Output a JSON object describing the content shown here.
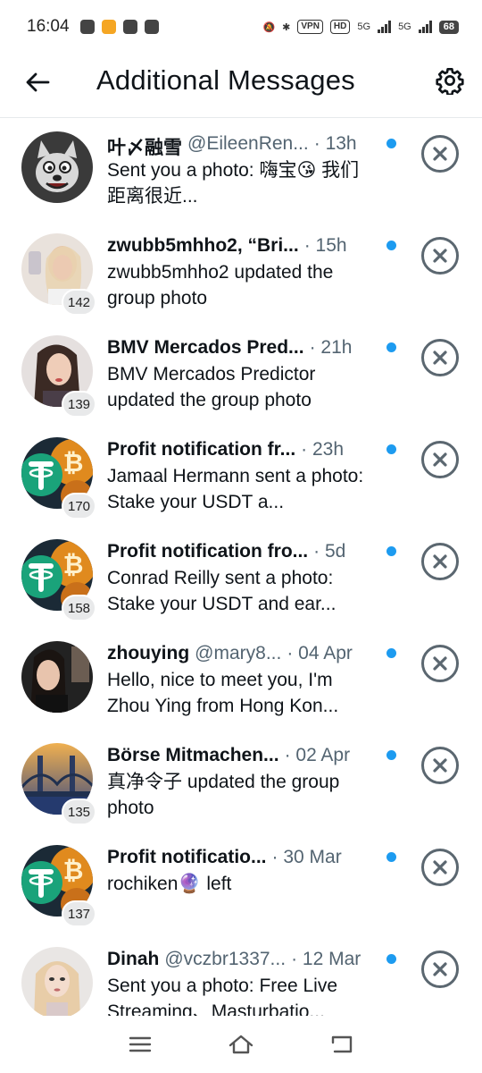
{
  "status_bar": {
    "time": "16:04",
    "vpn": "VPN",
    "hd": "HD",
    "net1": "5G",
    "net2": "5G",
    "battery": "68"
  },
  "header": {
    "title": "Additional Messages"
  },
  "colors": {
    "accent_dot": "#1d9bf0",
    "muted_text": "#536471"
  },
  "messages": [
    {
      "name": "叶〆融雪",
      "handle": "@EileenRen...",
      "time": "13h",
      "preview": "Sent you a photo: 嗨宝😘 我们距离很近...",
      "badge": "",
      "avatar": "cartoon-wolf"
    },
    {
      "name": "zwubb5mhho2, “Bri...",
      "handle": "",
      "time": "15h",
      "preview": "zwubb5mhho2 updated the group photo",
      "badge": "142",
      "avatar": "woman-selfie"
    },
    {
      "name": "BMV Mercados Pred...",
      "handle": "",
      "time": "21h",
      "preview": "BMV Mercados Predictor updated the group photo",
      "badge": "139",
      "avatar": "woman-portrait"
    },
    {
      "name": "Profit notification fr...",
      "handle": "",
      "time": "23h",
      "preview": "Jamaal Hermann sent a photo: Stake your USDT a...",
      "badge": "170",
      "avatar": "crypto"
    },
    {
      "name": "Profit notification fro...",
      "handle": "",
      "time": "5d",
      "preview": "Conrad Reilly sent a photo: Stake your USDT and ear...",
      "badge": "158",
      "avatar": "crypto"
    },
    {
      "name": "zhouying",
      "handle": "@mary8...",
      "time": "04 Apr",
      "preview": "Hello, nice to meet you, I'm Zhou Ying from Hong Kon...",
      "badge": "",
      "avatar": "woman-dark"
    },
    {
      "name": "Börse Mitmachen...",
      "handle": "",
      "time": "02 Apr",
      "preview": "真净令子 updated the group photo",
      "badge": "135",
      "avatar": "bridge"
    },
    {
      "name": "Profit notificatio...",
      "handle": "",
      "time": "30 Mar",
      "preview": "rochiken🔮 left",
      "badge": "137",
      "avatar": "crypto"
    },
    {
      "name": "Dinah",
      "handle": "@vczbr1337...",
      "time": "12 Mar",
      "preview": "Sent you a photo: Free Live Streaming、Masturbatio...",
      "badge": "",
      "avatar": "cartoon-woman"
    }
  ]
}
